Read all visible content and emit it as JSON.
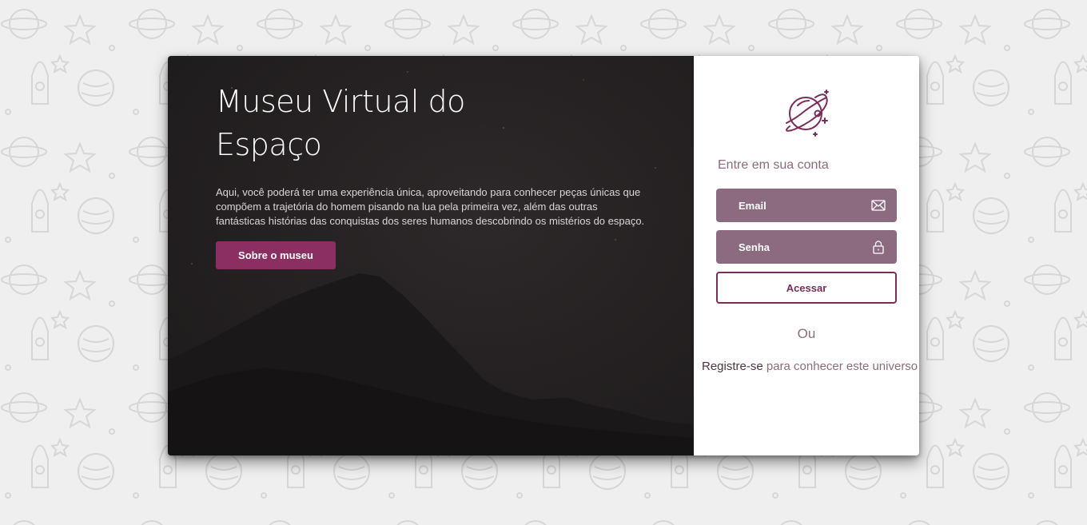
{
  "hero": {
    "title": "Museu Virtual do Espaço",
    "description": "Aqui, você poderá ter uma experiência única, aproveitando para conhecer peças únicas que compõem a trajetória do homem pisando na lua pela primeira vez, além das outras fantásticas histórias das conquistas dos seres humanos descobrindo os mistérios do espaço.",
    "about_button": "Sobre o museu"
  },
  "login": {
    "heading": "Entre em sua conta",
    "email_label": "Email",
    "password_label": "Senha",
    "access_button": "Acessar",
    "or_text": "Ou",
    "register_link": "Registre-se",
    "register_rest": " para conhecer este universo"
  },
  "icons": {
    "logo": "planet-icon",
    "email": "envelope-icon",
    "password": "lock-icon"
  },
  "colors": {
    "accent": "#8b2f63",
    "field_bg": "#8c6a80",
    "text_muted": "#8a6c7e",
    "page_bg": "#efefef"
  }
}
